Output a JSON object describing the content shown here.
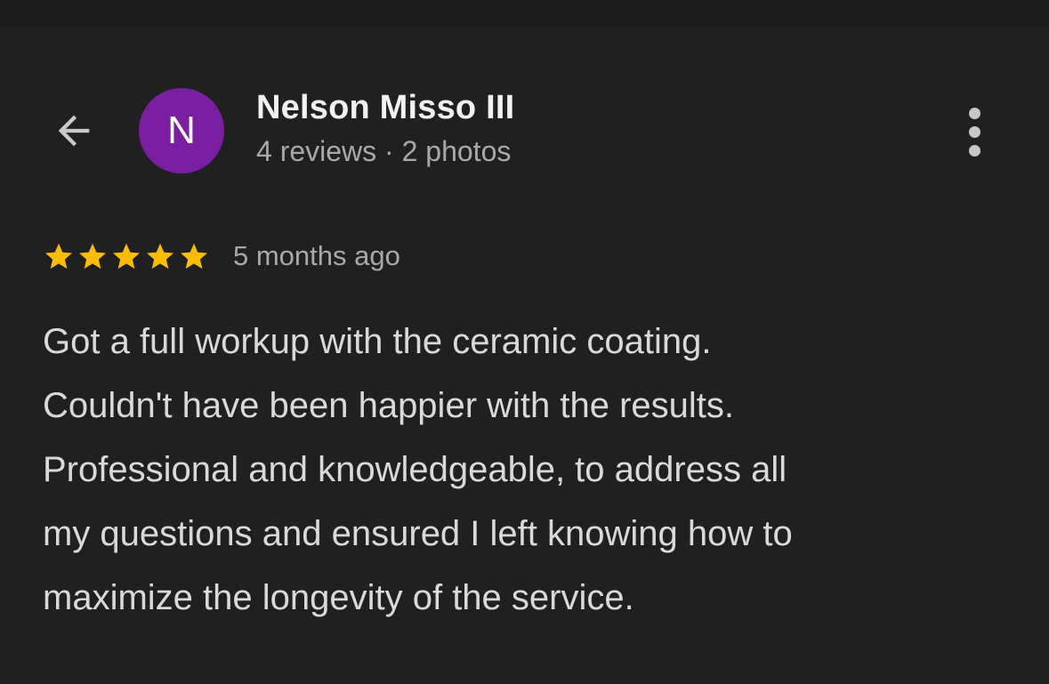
{
  "author": {
    "name": "Nelson Misso III",
    "initial": "N",
    "meta": "4 reviews · 2 photos",
    "avatar_color": "#7b1fa2"
  },
  "review": {
    "rating": 5,
    "max_rating": 5,
    "date": "5 months ago",
    "lines": [
      "Got a full workup with the ceramic coating.",
      "Couldn't have been happier with the results.",
      "Professional and knowledgeable, to address all",
      "my questions and ensured I left knowing how to",
      "maximize the longevity of the service."
    ]
  },
  "icons": {
    "back": "arrow-left-icon",
    "more": "more-vertical-icon",
    "star": "star-icon"
  },
  "colors": {
    "background": "#202020",
    "star": "#fbbc04",
    "text_primary": "#f1f1f1",
    "text_secondary": "#a9a9a9"
  }
}
